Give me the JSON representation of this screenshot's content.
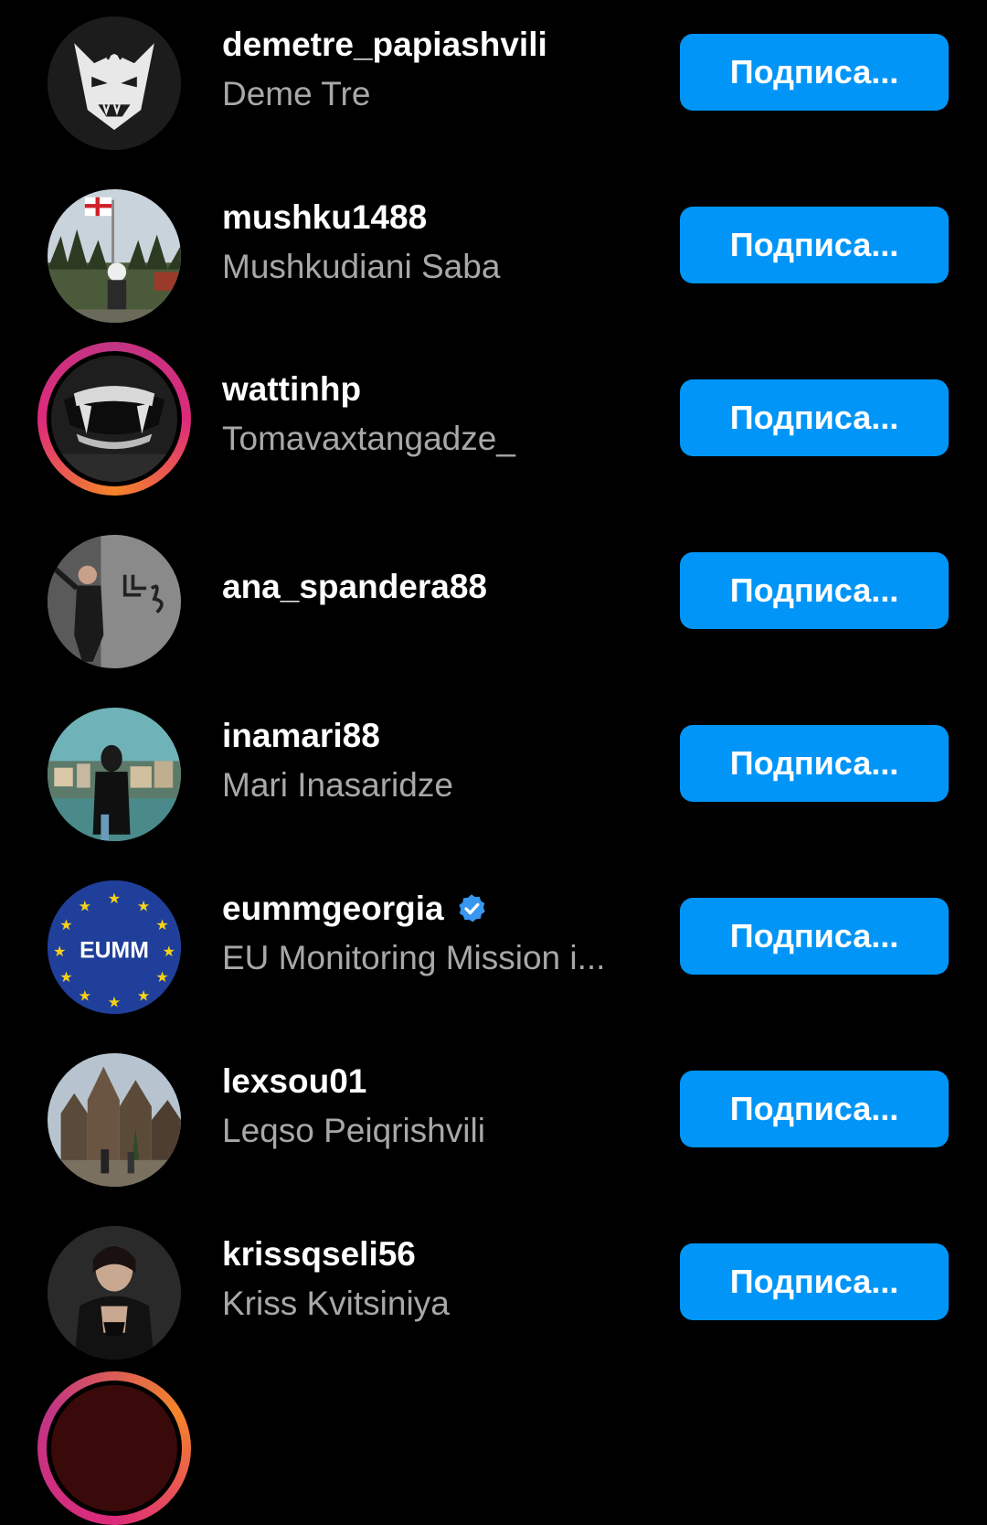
{
  "follow_label": "Подписа...",
  "accent_color": "#0095f6",
  "rows": [
    {
      "username": "demetre_papiashvili",
      "fullname": "Deme Tre",
      "story": false,
      "avatar_icon": "demon-mask-avatar"
    },
    {
      "username": "mushku1488",
      "fullname": "Mushkudiani Saba",
      "story": false,
      "avatar_icon": "landscape-flag-avatar"
    },
    {
      "username": "wattinhp",
      "fullname": "Tomavaxtangadze_",
      "story": true,
      "avatar_icon": "fangs-avatar"
    },
    {
      "username": "ana_spandera88",
      "fullname": "",
      "story": false,
      "avatar_icon": "person-wall-avatar"
    },
    {
      "username": "inamari88",
      "fullname": "Mari Inasaridze",
      "story": false,
      "avatar_icon": "city-person-avatar"
    },
    {
      "username": "eummgeorgia",
      "fullname": "EU Monitoring Mission i...",
      "story": false,
      "verified": true,
      "avatar_icon": "eumm-logo-avatar",
      "avatar_text": "EUMM"
    },
    {
      "username": "lexsou01",
      "fullname": "Leqso Peiqrishvili",
      "story": false,
      "avatar_icon": "cathedral-avatar"
    },
    {
      "username": "krissqseli56",
      "fullname": "Kriss Kvitsiniya",
      "story": false,
      "avatar_icon": "portrait-avatar"
    }
  ]
}
